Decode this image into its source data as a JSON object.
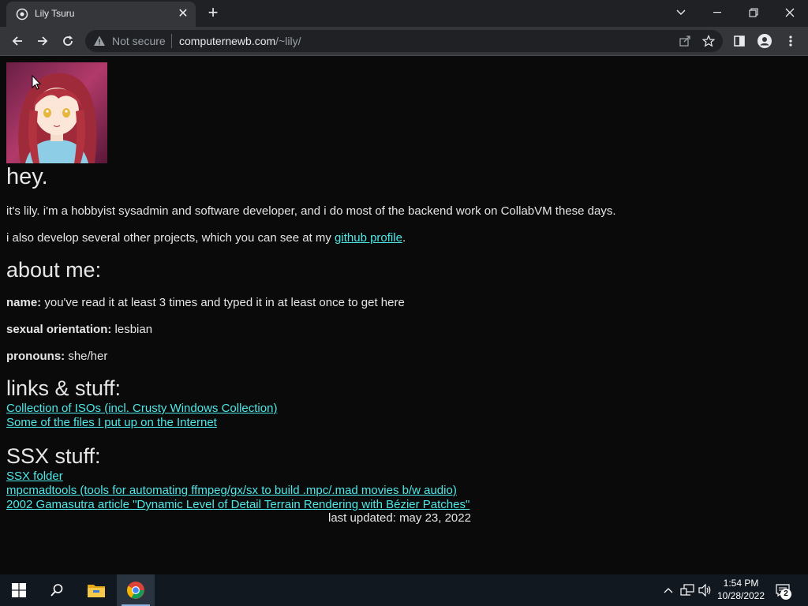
{
  "browser": {
    "tab_title": "Lily Tsuru",
    "tab_close_glyph": "✕",
    "new_tab_glyph": "+",
    "security_label": "Not secure",
    "url_host": "computernewb.com",
    "url_path": "/~lily/"
  },
  "page": {
    "greeting": "hey.",
    "intro_line1": "it's lily. i'm a hobbyist sysadmin and software developer, and i do most of the backend work on CollabVM these days.",
    "intro_line2_prefix": "i also develop several other projects, which you can see at my ",
    "intro_line2_link": "github profile",
    "intro_line2_suffix": ".",
    "about_heading": "about me:",
    "name_label": "name:",
    "name_value": " you've read it at least 3 times and typed it in at least once to get here",
    "orientation_label": "sexual orientation:",
    "orientation_value": " lesbian",
    "pronouns_label": "pronouns:",
    "pronouns_value": " she/her",
    "links_heading": "links & stuff:",
    "links": [
      "Collection of ISOs (incl. Crusty Windows Collection)",
      "Some of the files I put up on the Internet"
    ],
    "ssx_heading": "SSX stuff:",
    "ssx_links": [
      "SSX folder",
      "mpcmadtools (tools for automating ffmpeg/gx/sx to build .mpc/.mad movies b/w audio)",
      "2002 Gamasutra article \"Dynamic Level of Detail Terrain Rendering with Bézier Patches\""
    ],
    "last_updated": "last updated: may 23, 2022"
  },
  "taskbar": {
    "time": "1:54 PM",
    "date": "10/28/2022",
    "notification_count": "2"
  },
  "colors": {
    "page_bg": "#0a0a0a",
    "link": "#4ee8e8",
    "text": "#e6e6e6",
    "chrome_dark": "#202124",
    "chrome_toolbar": "#35363a",
    "taskbar": "#121820"
  }
}
